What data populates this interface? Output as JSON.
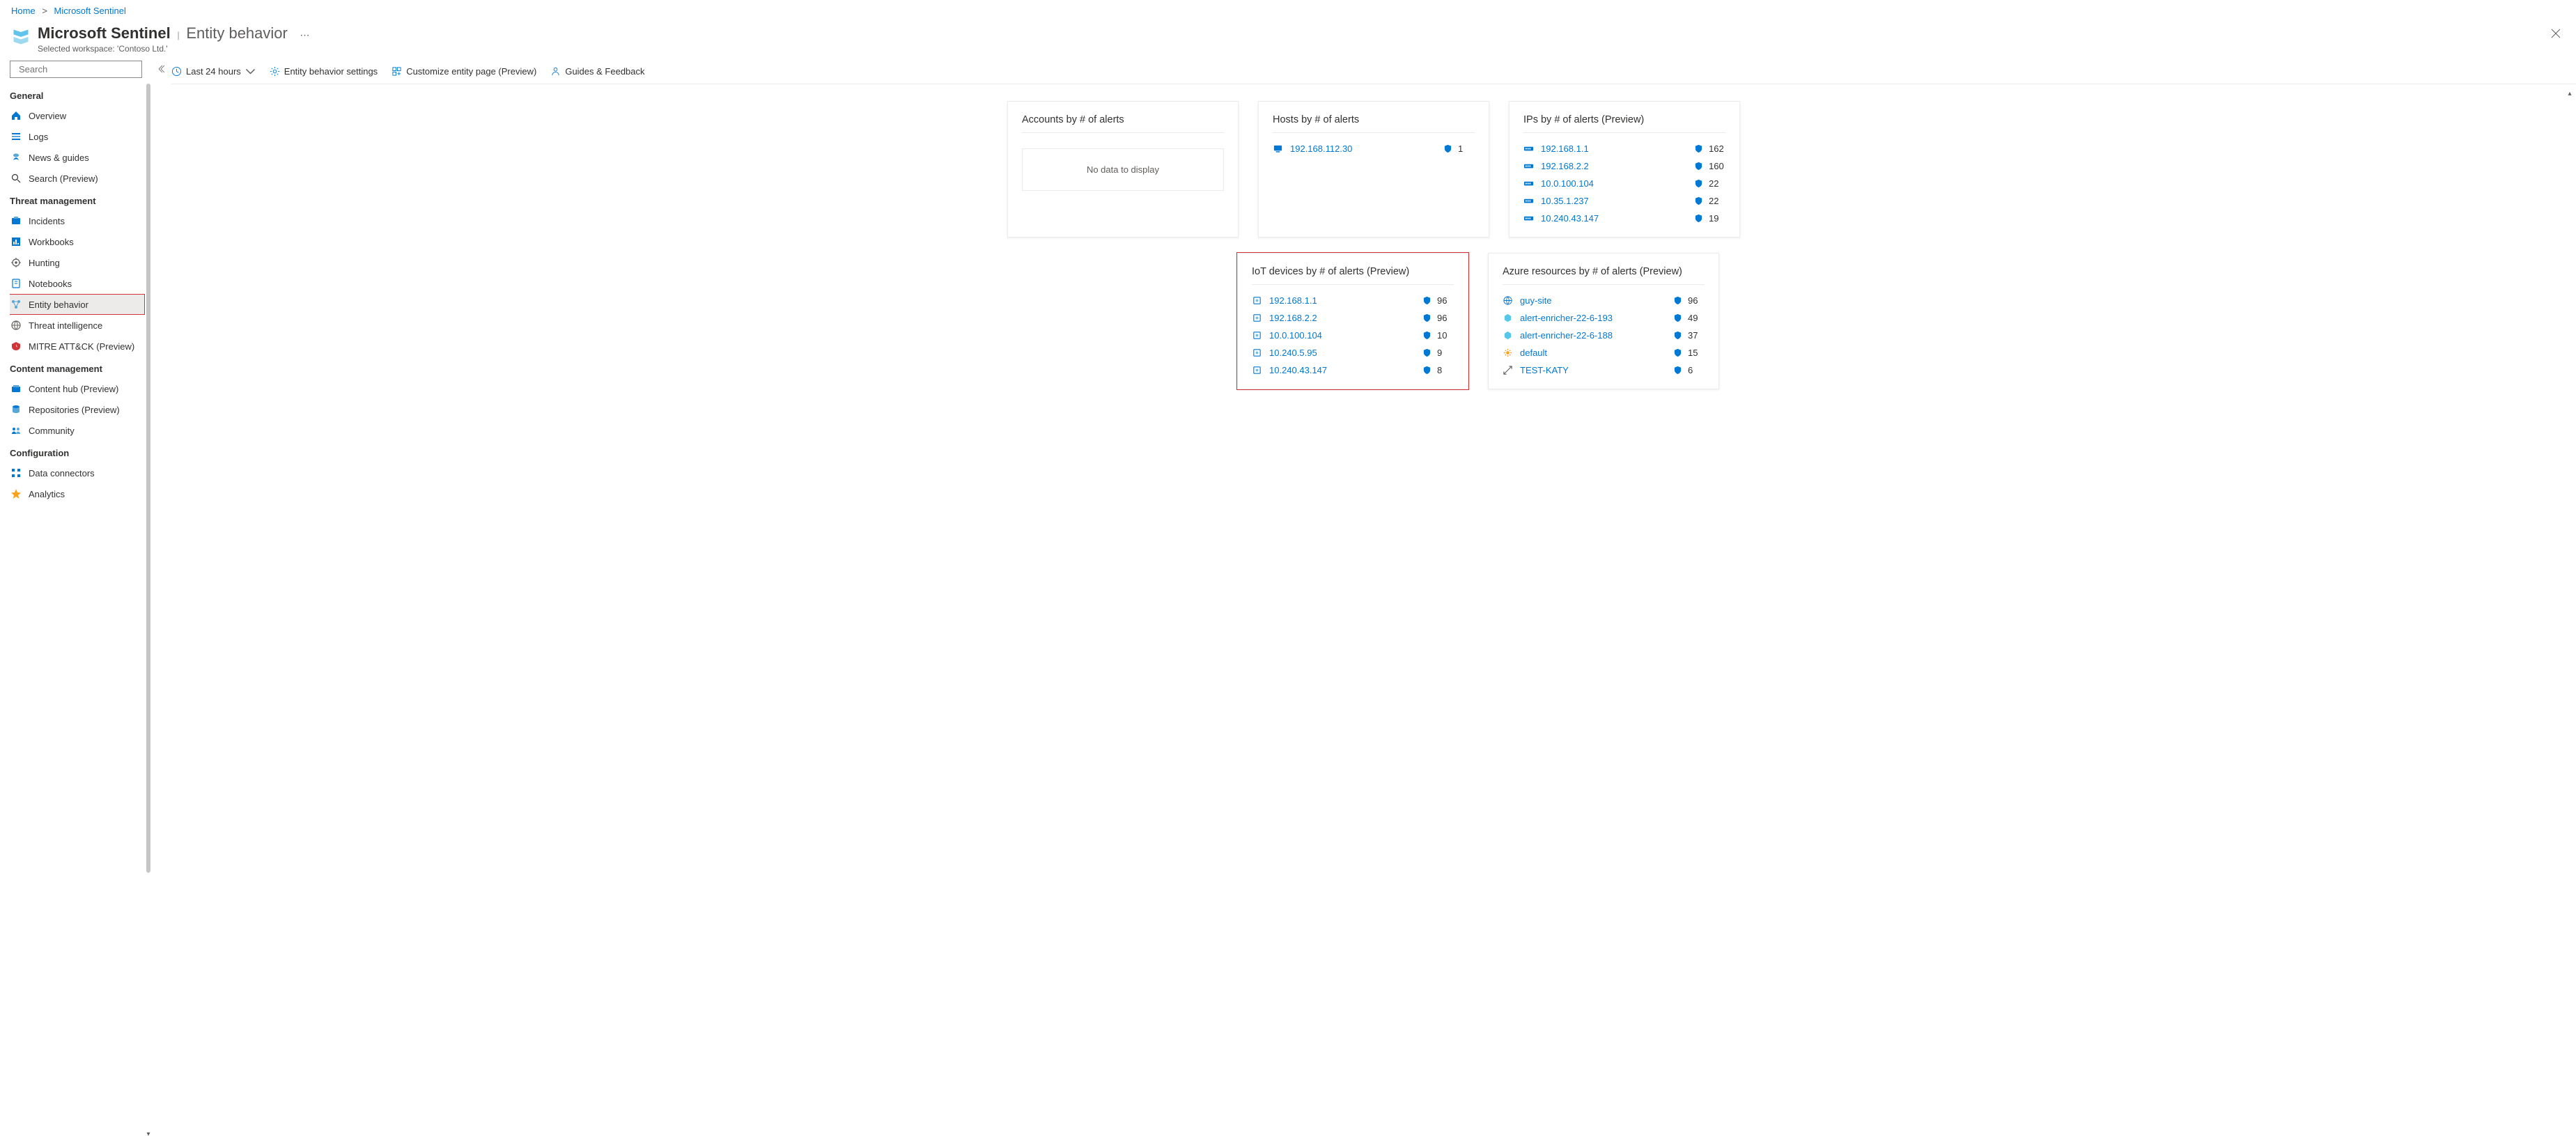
{
  "breadcrumb": {
    "home": "Home",
    "product": "Microsoft Sentinel"
  },
  "header": {
    "title": "Microsoft Sentinel",
    "subtitle": "Entity behavior",
    "workspace": "Selected workspace: 'Contoso Ltd.'"
  },
  "search": {
    "placeholder": "Search"
  },
  "nav": {
    "groups": [
      {
        "title": "General",
        "items": [
          {
            "label": "Overview",
            "icon": "overview"
          },
          {
            "label": "Logs",
            "icon": "logs"
          },
          {
            "label": "News & guides",
            "icon": "news"
          },
          {
            "label": "Search (Preview)",
            "icon": "search"
          }
        ]
      },
      {
        "title": "Threat management",
        "items": [
          {
            "label": "Incidents",
            "icon": "incidents"
          },
          {
            "label": "Workbooks",
            "icon": "workbooks"
          },
          {
            "label": "Hunting",
            "icon": "hunting"
          },
          {
            "label": "Notebooks",
            "icon": "notebooks"
          },
          {
            "label": "Entity behavior",
            "icon": "entity",
            "active": true,
            "highlighted": true
          },
          {
            "label": "Threat intelligence",
            "icon": "threat"
          },
          {
            "label": "MITRE ATT&CK (Preview)",
            "icon": "mitre"
          }
        ]
      },
      {
        "title": "Content management",
        "items": [
          {
            "label": "Content hub (Preview)",
            "icon": "content"
          },
          {
            "label": "Repositories (Preview)",
            "icon": "repos"
          },
          {
            "label": "Community",
            "icon": "community"
          }
        ]
      },
      {
        "title": "Configuration",
        "items": [
          {
            "label": "Data connectors",
            "icon": "connectors"
          },
          {
            "label": "Analytics",
            "icon": "analytics"
          }
        ]
      }
    ]
  },
  "toolbar": {
    "time": "Last 24 hours",
    "settings": "Entity behavior settings",
    "customize": "Customize entity page (Preview)",
    "guides": "Guides & Feedback"
  },
  "cards": {
    "accounts": {
      "title": "Accounts by # of alerts",
      "empty": "No data to display"
    },
    "hosts": {
      "title": "Hosts by # of alerts",
      "rows": [
        {
          "name": "192.168.112.30",
          "count": "1"
        }
      ]
    },
    "ips": {
      "title": "IPs by # of alerts (Preview)",
      "rows": [
        {
          "name": "192.168.1.1",
          "count": "162"
        },
        {
          "name": "192.168.2.2",
          "count": "160"
        },
        {
          "name": "10.0.100.104",
          "count": "22"
        },
        {
          "name": "10.35.1.237",
          "count": "22"
        },
        {
          "name": "10.240.43.147",
          "count": "19"
        }
      ]
    },
    "iot": {
      "title": "IoT devices by # of alerts (Preview)",
      "rows": [
        {
          "name": "192.168.1.1",
          "count": "96"
        },
        {
          "name": "192.168.2.2",
          "count": "96"
        },
        {
          "name": "10.0.100.104",
          "count": "10"
        },
        {
          "name": "10.240.5.95",
          "count": "9"
        },
        {
          "name": "10.240.43.147",
          "count": "8"
        }
      ]
    },
    "azure": {
      "title": "Azure resources by # of alerts (Preview)",
      "rows": [
        {
          "name": "guy-site",
          "count": "96",
          "icon": "web"
        },
        {
          "name": "alert-enricher-22-6-193",
          "count": "49",
          "icon": "res"
        },
        {
          "name": "alert-enricher-22-6-188",
          "count": "37",
          "icon": "res"
        },
        {
          "name": "default",
          "count": "15",
          "icon": "gear"
        },
        {
          "name": "TEST-KATY",
          "count": "6",
          "icon": "scale"
        }
      ]
    }
  }
}
